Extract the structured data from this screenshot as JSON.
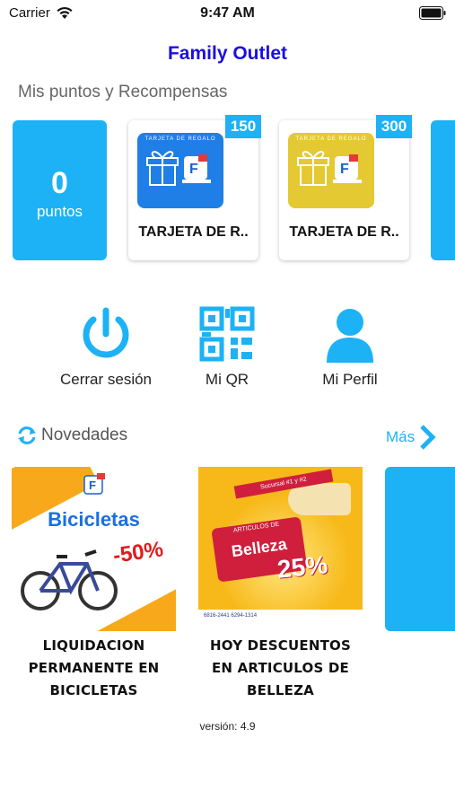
{
  "status_bar": {
    "carrier": "Carrier",
    "time": "9:47 AM"
  },
  "app": {
    "title": "Family Outlet"
  },
  "rewards": {
    "section_title": "Mis puntos y Recompensas",
    "points_value": "0",
    "points_label": "puntos",
    "items": [
      {
        "cost": "150",
        "name": "TARJETA DE R..",
        "card_color": "#1f7fe6",
        "card_title": "TARJETA DE REGALO"
      },
      {
        "cost": "300",
        "name": "TARJETA DE R..",
        "card_color": "#e4c932",
        "card_title": "TARJETA DE REGALO"
      }
    ]
  },
  "actions": [
    {
      "label": "Cerrar sesión",
      "icon": "power-icon"
    },
    {
      "label": "Mi QR",
      "icon": "qr-code-icon"
    },
    {
      "label": "Mi Perfil",
      "icon": "user-icon"
    }
  ],
  "news": {
    "title": "Novedades",
    "more_label": "Más",
    "items": [
      {
        "caption": "LIQUIDACION PERMANENTE EN BICICLETAS",
        "image_headline": "Bicicletas",
        "image_discount": "-50%"
      },
      {
        "caption": "HOY DESCUENTOS EN ARTICULOS DE BELLEZA",
        "image_banner": "Sucursal #1 y #2",
        "image_ribbon_sub": "ARTICULOS DE",
        "image_ribbon_main": "Belleza",
        "image_discount": "25%",
        "image_phones": "6816-2441   6294-1314"
      }
    ]
  },
  "version": "versión: 4.9",
  "colors": {
    "accent": "#1cb2f5",
    "title": "#1a0fe0"
  }
}
